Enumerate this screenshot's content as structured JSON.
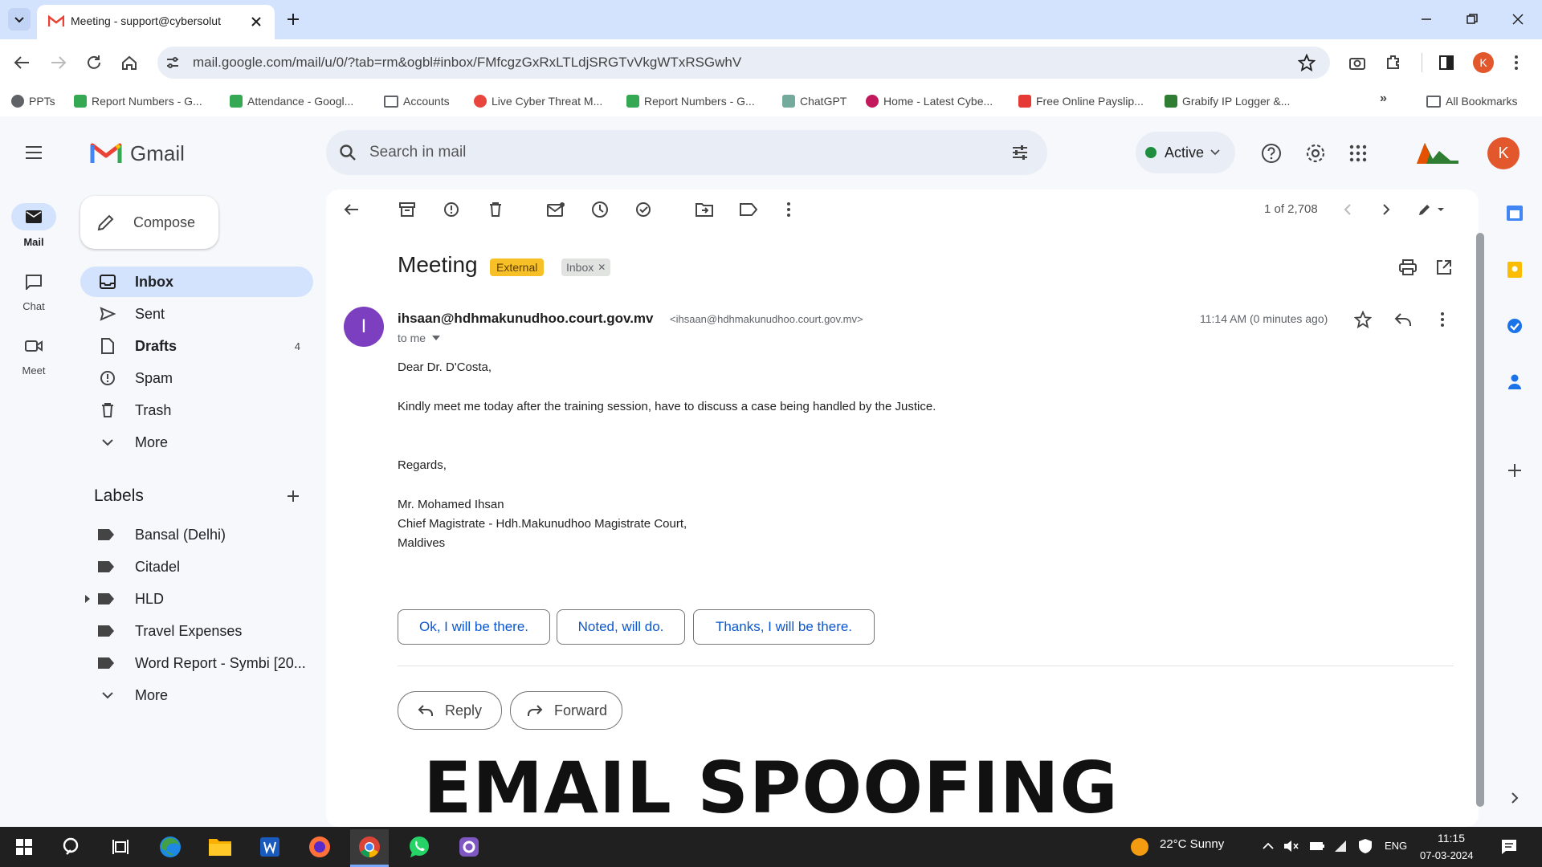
{
  "browser": {
    "tab_title": "Meeting - support@cybersolut",
    "url": "mail.google.com/mail/u/0/?tab=rm&ogbl#inbox/FMfcgzGxRxLTLdjSRGTvVkgWTxRSGwhV",
    "avatar_letter": "K",
    "bookmarks": [
      {
        "label": "PPTs",
        "color": "#5f6368"
      },
      {
        "label": "Report Numbers - G...",
        "color": "#34a853"
      },
      {
        "label": "Attendance - Googl...",
        "color": "#34a853"
      },
      {
        "label": "Accounts",
        "color": "#5f6368"
      },
      {
        "label": "Live Cyber Threat M...",
        "color": "#e8453c"
      },
      {
        "label": "Report Numbers - G...",
        "color": "#34a853"
      },
      {
        "label": "ChatGPT",
        "color": "#74aa9c"
      },
      {
        "label": "Home - Latest Cybe...",
        "color": "#c2185b"
      },
      {
        "label": "Free Online Payslip...",
        "color": "#e53935"
      },
      {
        "label": "Grabify IP Logger &...",
        "color": "#2e7d32"
      }
    ],
    "all_bookmarks": "All Bookmarks"
  },
  "gmail": {
    "logo_text": "Gmail",
    "search_placeholder": "Search in mail",
    "status": "Active",
    "avatar_letter": "K",
    "rail": [
      {
        "label": "Mail"
      },
      {
        "label": "Chat"
      },
      {
        "label": "Meet"
      }
    ],
    "compose": "Compose",
    "nav": [
      {
        "label": "Inbox",
        "count": ""
      },
      {
        "label": "Sent",
        "count": ""
      },
      {
        "label": "Drafts",
        "count": "4"
      },
      {
        "label": "Spam",
        "count": ""
      },
      {
        "label": "Trash",
        "count": ""
      },
      {
        "label": "More",
        "count": ""
      }
    ],
    "labels_heading": "Labels",
    "labels": [
      "Bansal (Delhi)",
      "Citadel",
      "HLD",
      "Travel Expenses",
      "Word Report - Symbi [20...",
      "More"
    ],
    "pagination": "1 of 2,708",
    "message": {
      "subject": "Meeting",
      "badge_external": "External",
      "badge_inbox": "Inbox",
      "avatar_letter": "I",
      "sender_name": "ihsaan@hdhmakunudhoo.court.gov.mv",
      "sender_email": "<ihsaan@hdhmakunudhoo.court.gov.mv>",
      "to": "to me",
      "time": "11:14 AM (0 minutes ago)",
      "body": [
        "Dear Dr. D'Costa,",
        "Kindly meet me today after the training session, have to discuss a case being handled by the Justice.",
        "Regards,",
        "Mr. Mohamed Ihsan",
        "Chief Magistrate - Hdh.Makunudhoo Magistrate Court,",
        "Maldives"
      ],
      "smart_replies": [
        "Ok, I will be there.",
        "Noted, will do.",
        "Thanks, I will be there."
      ],
      "reply": "Reply",
      "forward": "Forward"
    }
  },
  "overlay_caption": "EMAIL SPOOFING",
  "taskbar": {
    "weather": "22°C  Sunny",
    "lang": "ENG",
    "time": "11:15",
    "date": "07-03-2024"
  },
  "colors": {
    "accent": "#0b57d0",
    "external_badge": "#f6c026",
    "sender_avatar": "#7b3fbf",
    "user_avatar": "#e2572b"
  }
}
